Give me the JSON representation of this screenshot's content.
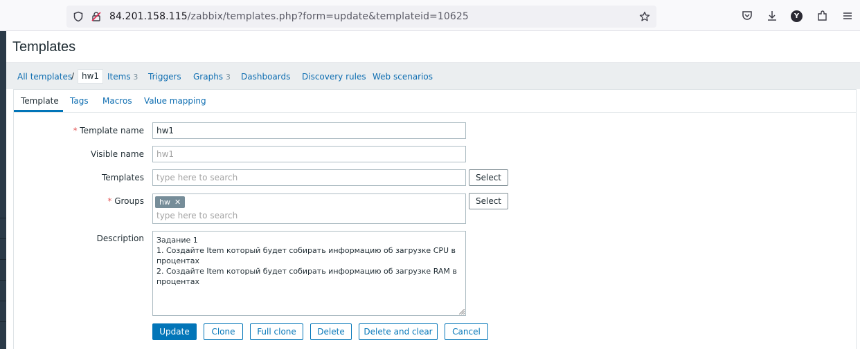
{
  "browser": {
    "url_host": "84.201.158.115",
    "url_path": "/zabbix/templates.php?form=update&templateid=10625",
    "profile_initial": "Y",
    "icons": [
      "shield-icon",
      "insecure-lock-icon",
      "bookmark-star-icon",
      "pocket-icon",
      "downloads-icon",
      "account-icon",
      "extensions-icon",
      "menu-icon"
    ]
  },
  "page": {
    "title": "Templates"
  },
  "breadcrumb": {
    "all_templates": "All templates",
    "separator": "/",
    "current": "hw1",
    "items": {
      "label": "Items",
      "count": "3"
    },
    "triggers": {
      "label": "Triggers"
    },
    "graphs": {
      "label": "Graphs",
      "count": "3"
    },
    "dashboards": {
      "label": "Dashboards"
    },
    "discovery": {
      "label": "Discovery rules"
    },
    "web": {
      "label": "Web scenarios"
    }
  },
  "tabs": {
    "template": "Template",
    "tags": "Tags",
    "macros": "Macros",
    "value_mapping": "Value mapping"
  },
  "form": {
    "required_mark": "*",
    "template_name": {
      "label": "Template name",
      "value": "hw1"
    },
    "visible_name": {
      "label": "Visible name",
      "placeholder": "hw1"
    },
    "templates": {
      "label": "Templates",
      "placeholder": "type here to search",
      "select": "Select"
    },
    "groups": {
      "label": "Groups",
      "chip": "hw",
      "chip_remove": "✕",
      "placeholder": "type here to search",
      "select": "Select"
    },
    "description": {
      "label": "Description",
      "value": "Задание 1\n1. Создайте Item который будет собирать информацию об загрузке CPU в процентах\n2. Создайте Item который будет собирать информацию об загрузке RAM в процентах"
    }
  },
  "actions": {
    "update": "Update",
    "clone": "Clone",
    "full_clone": "Full clone",
    "delete": "Delete",
    "delete_and_clear": "Delete and clear",
    "cancel": "Cancel"
  },
  "colors": {
    "link": "#0d6db1",
    "primary": "#0275b8",
    "required": "#e45959",
    "chip": "#768d99"
  }
}
